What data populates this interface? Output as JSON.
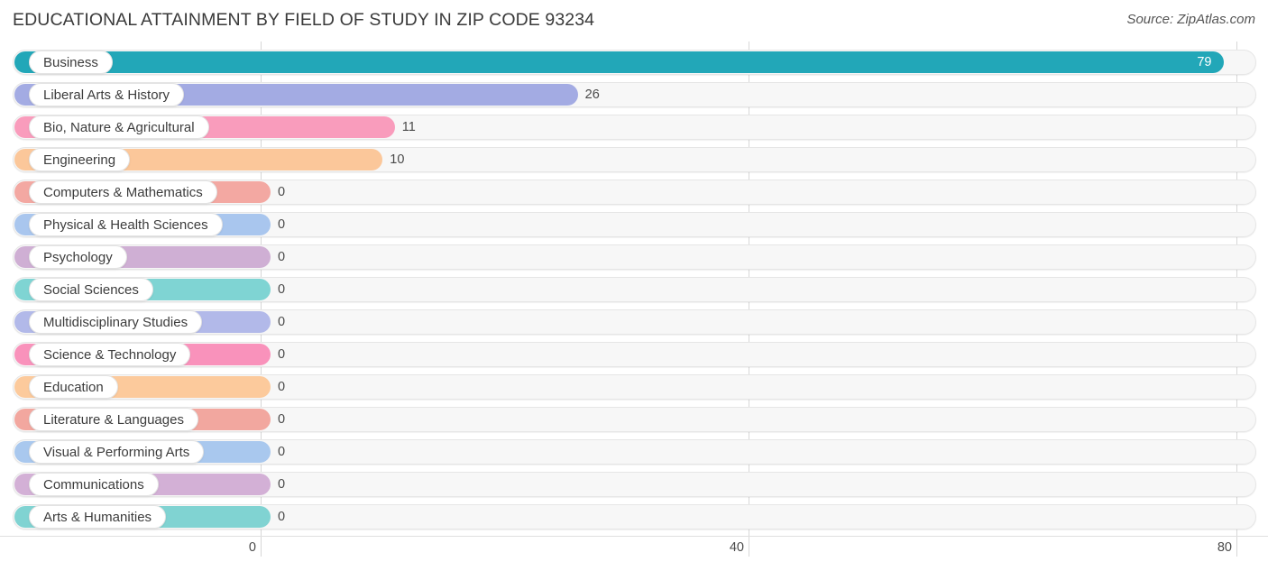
{
  "header": {
    "title": "EDUCATIONAL ATTAINMENT BY FIELD OF STUDY IN ZIP CODE 93234",
    "source": "Source: ZipAtlas.com"
  },
  "chart_data": {
    "type": "bar",
    "orientation": "horizontal",
    "title": "EDUCATIONAL ATTAINMENT BY FIELD OF STUDY IN ZIP CODE 93234",
    "xlabel": "",
    "ylabel": "",
    "xlim": [
      0,
      80
    ],
    "xticks": [
      0,
      40,
      80
    ],
    "xtick_labels": [
      "0",
      "40",
      "80"
    ],
    "grid": true,
    "legend": false,
    "categories": [
      "Business",
      "Liberal Arts & History",
      "Bio, Nature & Agricultural",
      "Engineering",
      "Computers & Mathematics",
      "Physical & Health Sciences",
      "Psychology",
      "Social Sciences",
      "Multidisciplinary Studies",
      "Science & Technology",
      "Education",
      "Literature & Languages",
      "Visual & Performing Arts",
      "Communications",
      "Arts & Humanities"
    ],
    "values": [
      79,
      26,
      11,
      10,
      0,
      0,
      0,
      0,
      0,
      0,
      0,
      0,
      0,
      0,
      0
    ],
    "value_labels": [
      "79",
      "26",
      "11",
      "10",
      "0",
      "0",
      "0",
      "0",
      "0",
      "0",
      "0",
      "0",
      "0",
      "0",
      "0"
    ],
    "colors": [
      "#22a7b8",
      "#a3abe3",
      "#f99cbc",
      "#fbc79a",
      "#f3a8a2",
      "#a9c6ee",
      "#cfafd4",
      "#7fd4d3",
      "#b2b9e9",
      "#f992bb",
      "#fcca9c",
      "#f2a79f",
      "#a9c8ee",
      "#d3b0d6",
      "#80d3d2"
    ]
  }
}
